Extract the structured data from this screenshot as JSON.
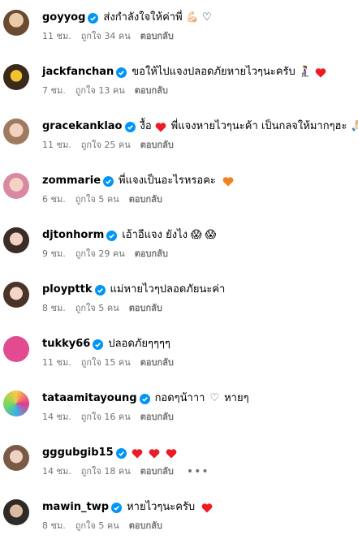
{
  "labels": {
    "reply": "ตอบกลับ"
  },
  "colors": {
    "verified": "#0095f6",
    "heart": "#ed1c24",
    "orange_heart": "#f4811f",
    "meta": "#737373"
  },
  "comments": [
    {
      "username": "goyyog",
      "text": "ส่งกำลังใจให้ค่าพี่",
      "extra": "💪🏻 ♡",
      "time": "11 ชม.",
      "likes": "ถูกใจ 34 คน"
    },
    {
      "username": "jackfanchan",
      "text": "ขอให้ไปแจงปลอดภัยหายไวๆนะครับ",
      "extra": "🧎‍♀️",
      "time": "7 ชม.",
      "likes": "ถูกใจ 13 คน"
    },
    {
      "username": "gracekanklao",
      "text": "งื้อ",
      "text2": "พี่แจงหายไวๆนะค้า เป็นกลจให้มากๆฮะ",
      "extra": "🙏🏻",
      "time": "11 ชม.",
      "likes": "ถูกใจ 25 คน"
    },
    {
      "username": "zommarie",
      "text": "พี่แจงเป็นอะไรหรอคะ",
      "time": "6 ชม.",
      "likes": "ถูกใจ 5 คน"
    },
    {
      "username": "djtonhorm",
      "text": "เอ้าอีแจง ยังไง",
      "extra": "😱 😱",
      "time": "9 ชม.",
      "likes": "ถูกใจ 29 คน"
    },
    {
      "username": "ploypttk",
      "text": "แม่หายไวๆปลอดภัยนะค่า",
      "time": "8 ชม.",
      "likes": "ถูกใจ 5 คน"
    },
    {
      "username": "tukky66",
      "text": "ปลอดภัยๆๆๆๆ",
      "time": "11 ชม.",
      "likes": "ถูกใจ 15 คน"
    },
    {
      "username": "tataamitayoung",
      "text": "กอดๆน้าาา",
      "text2": "หายๆ",
      "extra": "♡",
      "time": "14 ชม.",
      "likes": "ถูกใจ 16 คน"
    },
    {
      "username": "gggubgib15",
      "text": "",
      "time": "14 ชม.",
      "likes": "ถูกใจ 18 คน",
      "more": "•••"
    },
    {
      "username": "mawin_twp",
      "text": "หายไวๆนะครับ",
      "time": "8 ชม.",
      "likes": "ถูกใจ 5 คน"
    }
  ]
}
